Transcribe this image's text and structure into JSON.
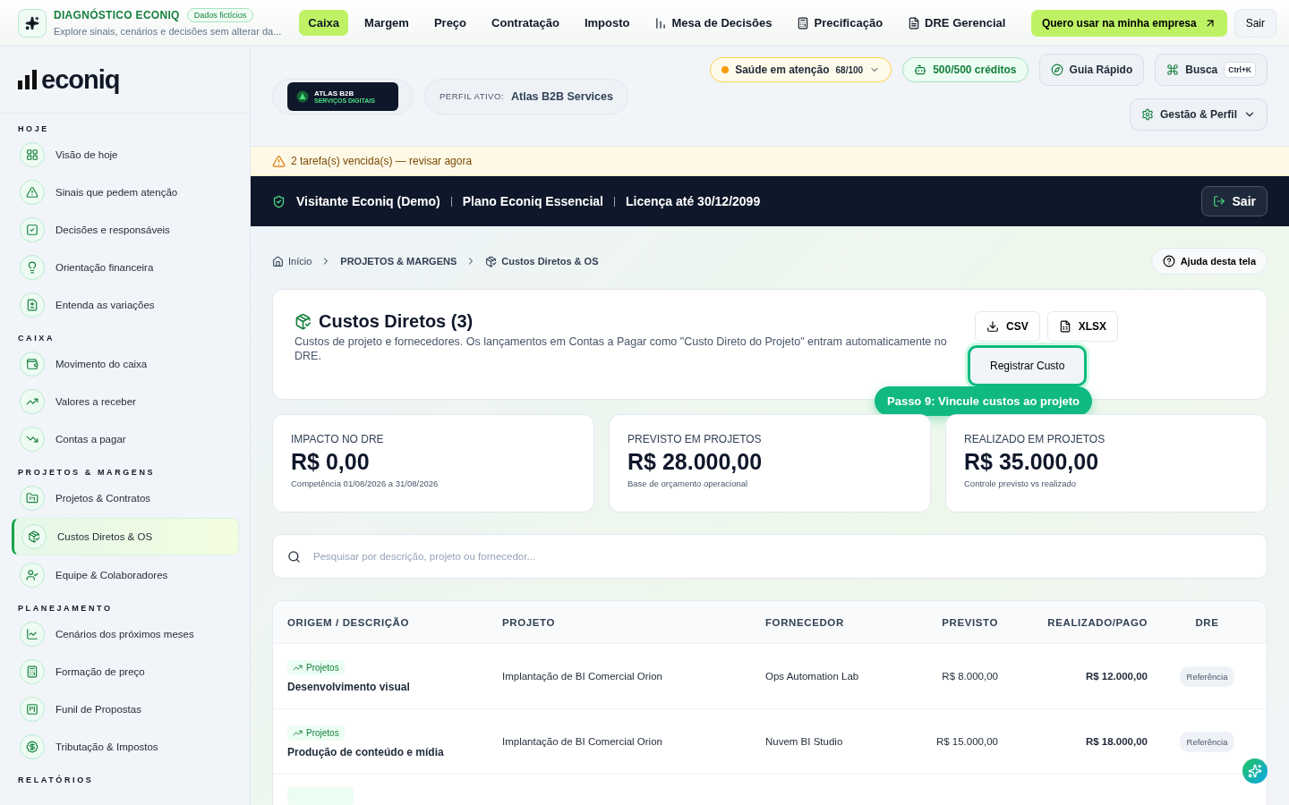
{
  "topbar": {
    "title": "DIAGNÓSTICO ECONIQ",
    "badge": "Dados fictícios",
    "subtitle": "Explore sinais, cenários e decisões sem alterar da...",
    "tabs": [
      {
        "label": "Caixa",
        "selected": true
      },
      {
        "label": "Margem",
        "selected": false
      },
      {
        "label": "Preço",
        "selected": false
      },
      {
        "label": "Contratação",
        "selected": false
      },
      {
        "label": "Imposto",
        "selected": false
      },
      {
        "label": "Mesa de Decisões",
        "selected": false
      },
      {
        "label": "Precificação",
        "selected": false
      },
      {
        "label": "DRE Gerencial",
        "selected": false
      }
    ],
    "cta": "Quero usar na minha empresa",
    "exit": "Sair"
  },
  "sidebar": {
    "logo": "econiq",
    "sections": [
      {
        "title": "HOJE",
        "items": [
          {
            "label": "Visão de hoje",
            "selected": false
          },
          {
            "label": "Sinais que pedem atenção",
            "selected": false
          },
          {
            "label": "Decisões e responsáveis",
            "selected": false
          },
          {
            "label": "Orientação financeira",
            "selected": false
          },
          {
            "label": "Entenda as variações",
            "selected": false
          }
        ]
      },
      {
        "title": "CAIXA",
        "items": [
          {
            "label": "Movimento do caixa",
            "selected": false
          },
          {
            "label": "Valores a receber",
            "selected": false
          },
          {
            "label": "Contas a pagar",
            "selected": false
          }
        ]
      },
      {
        "title": "PROJETOS & MARGENS",
        "items": [
          {
            "label": "Projetos & Contratos",
            "selected": false
          },
          {
            "label": "Custos Diretos & OS",
            "selected": true
          },
          {
            "label": "Equipe & Colaboradores",
            "selected": false
          }
        ]
      },
      {
        "title": "PLANEJAMENTO",
        "items": [
          {
            "label": "Cenários dos próximos meses",
            "selected": false
          },
          {
            "label": "Formação de preço",
            "selected": false
          },
          {
            "label": "Funil de Propostas",
            "selected": false
          },
          {
            "label": "Tributação & Impostos",
            "selected": false
          }
        ]
      },
      {
        "title": "RELATÓRIOS"
      }
    ]
  },
  "header": {
    "company_logo": {
      "name": "ATLAS B2B",
      "tagline": "SERVIÇOS DIGITAIS"
    },
    "profile_label": "PERFIL ATIVO:",
    "profile": "Atlas B2B Services",
    "health": {
      "label": "Saúde em atenção",
      "score": "68/100"
    },
    "credits": "500/500 créditos",
    "guide": "Guia Rápido",
    "search": {
      "label": "Busca",
      "shortcut": "Ctrl+K"
    },
    "settings": "Gestão & Perfil"
  },
  "alert": "2 tarefa(s) vencida(s) — revisar agora",
  "account_bar": {
    "items": [
      "Visitante Econiq (Demo)",
      "Plano Econiq Essencial",
      "Licença até 30/12/2099"
    ],
    "exit": "Sair"
  },
  "breadcrumb": [
    "Início",
    "PROJETOS & MARGENS",
    "Custos Diretos & OS"
  ],
  "help": "Ajuda desta tela",
  "page": {
    "title": "Custos Diretos (3)",
    "description": "Custos de projeto e fornecedores. Os lançamentos em Contas a Pagar como \"Custo Direto do Projeto\" entram automaticamente no DRE.",
    "exports": [
      "CSV",
      "XLSX"
    ],
    "primary": "Registrar Custo",
    "tour_tip": "Passo 9: Vincule custos ao projeto"
  },
  "stats": [
    {
      "label": "IMPACTO NO DRE",
      "value": "R$ 0,00",
      "note": "Competência 01/08/2026 a 31/08/2026"
    },
    {
      "label": "PREVISTO EM PROJETOS",
      "value": "R$ 28.000,00",
      "note": "Base de orçamento operacional"
    },
    {
      "label": "REALIZADO EM PROJETOS",
      "value": "R$ 35.000,00",
      "note": "Controle previsto vs realizado"
    }
  ],
  "search": {
    "placeholder": "Pesquisar por descrição, projeto ou fornecedor..."
  },
  "table": {
    "columns": [
      "ORIGEM / DESCRIÇÃO",
      "PROJETO",
      "FORNECEDOR",
      "PREVISTO",
      "REALIZADO/PAGO",
      "DRE"
    ],
    "rows": [
      {
        "tag": "Projetos",
        "description": "Desenvolvimento visual",
        "project": "Implantação de BI Comercial Orion",
        "supplier": "Ops Automation Lab",
        "planned": "R$ 8.000,00",
        "paid": "R$ 12.000,00",
        "dre": "Referência"
      },
      {
        "tag": "Projetos",
        "description": "Produção de conteúdo e mídia",
        "project": "Implantação de BI Comercial Orion",
        "supplier": "Nuvem BI Studio",
        "planned": "R$ 15.000,00",
        "paid": "R$ 18.000,00",
        "dre": "Referência"
      }
    ]
  }
}
